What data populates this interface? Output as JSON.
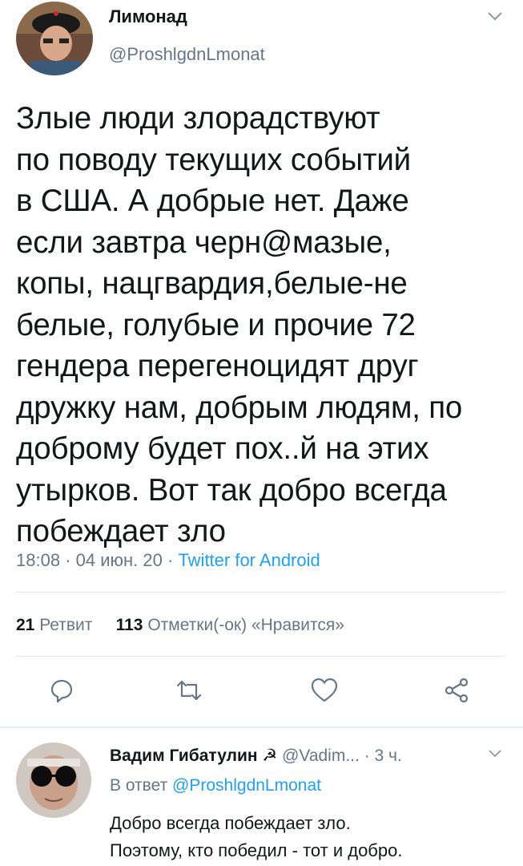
{
  "tweet": {
    "author_name": "Лимонад",
    "author_handle": "@ProshlgdnLmonat",
    "text_lines": [
      "Злые люди злорадствуют",
      "по поводу текущих событий",
      "в США. А добрые нет. Даже",
      "если завтра черн@мазые,",
      "копы, нацгвардия,белые-не",
      "белые, голубые и прочие 72",
      "гендера перегеноцидят друг",
      "дружку нам, добрым людям, по",
      "доброму будет пох..й на этих",
      "утырков. Вот так добро всегда",
      "побеждает зло"
    ],
    "time": "18:08",
    "date": "04 июн. 20",
    "sep": "·",
    "client": "Twitter for Android",
    "retweets_count": "21",
    "retweets_label": "Ретвит",
    "likes_count": "113",
    "likes_label": "Отметки(-ок) «Нравится»"
  },
  "reply": {
    "author_name": "Вадим Гибатулин",
    "author_emoji": "☭",
    "author_handle": "@Vadim...",
    "time": "· 3 ч.",
    "in_reply_prefix": "В ответ",
    "in_reply_handle": "@ProshlgdnLmonat",
    "text_lines": [
      "Добро всегда побеждает зло.",
      "Поэтому, кто победил - тот и добро."
    ]
  },
  "icons": [
    "chevron-down-icon",
    "reply-icon",
    "retweet-icon",
    "like-icon",
    "share-icon"
  ],
  "colors": {
    "link": "#1da1f2",
    "muted": "#657786",
    "text": "#14171a",
    "divider": "#e1e8ed"
  }
}
